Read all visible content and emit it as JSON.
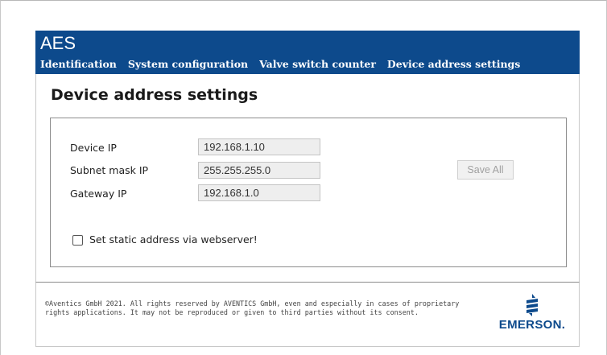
{
  "app": {
    "title": "AES"
  },
  "nav": {
    "items": [
      {
        "label": "Identification"
      },
      {
        "label": "System configuration"
      },
      {
        "label": "Valve switch counter"
      },
      {
        "label": "Device address settings"
      }
    ]
  },
  "page": {
    "title": "Device address settings"
  },
  "form": {
    "device_ip": {
      "label": "Device IP",
      "value": "192.168.1.10"
    },
    "subnet_mask": {
      "label": "Subnet mask IP",
      "value": "255.255.255.0"
    },
    "gateway_ip": {
      "label": "Gateway IP",
      "value": "192.168.1.0"
    },
    "save_label": "Save All",
    "static_checkbox": {
      "label": "Set static address via webserver!",
      "checked": false
    }
  },
  "footer": {
    "copyright": "©Aventics GmbH 2021. All rights reserved by AVENTICS GmbH, even and especially in cases of proprietary rights applications. It may not be reproduced or given to third parties without its consent.",
    "logo_text": "EMERSON."
  },
  "colors": {
    "brand": "#0d4a8c",
    "header_text": "#ffffff",
    "input_bg": "#eeeeee",
    "disabled_text": "#a0a0a0"
  },
  "icons": {
    "logo": "emerson-logo-icon",
    "checkbox": "checkbox-icon"
  }
}
